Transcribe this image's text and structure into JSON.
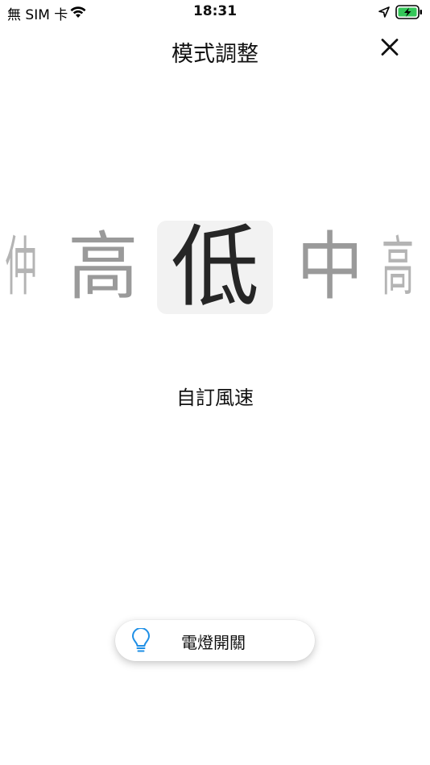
{
  "status_bar": {
    "carrier": "無 SIM 卡",
    "time": "18:31",
    "wifi_icon": "wifi-icon",
    "location_icon": "location-arrow-icon",
    "battery_icon": "battery-charging-icon",
    "battery_color": "#34c759"
  },
  "header": {
    "title": "模式調整",
    "close_icon": "close-icon"
  },
  "picker": {
    "options": [
      "仲",
      "高",
      "低",
      "中",
      "高"
    ],
    "selected": "低",
    "selected_bg": "#f2f2f2"
  },
  "custom_speed_label": "自訂風速",
  "light_toggle": {
    "label": "電燈開關",
    "icon": "lightbulb-icon",
    "icon_color": "#1e8fe6"
  }
}
